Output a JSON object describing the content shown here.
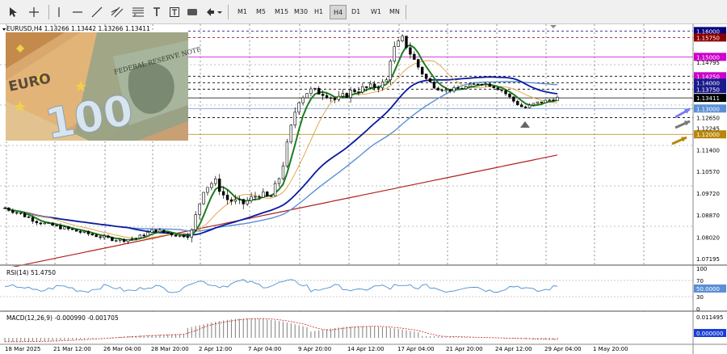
{
  "toolbar": {
    "timeframes": [
      "M1",
      "M5",
      "M15",
      "M30",
      "H1",
      "H4",
      "D1",
      "W1",
      "MN"
    ],
    "active_timeframe": "H4"
  },
  "chart": {
    "symbol_header": "EURUSD,H4  1.13266 1.13442 1.13266 1.13411",
    "price_axis": [
      "1.16000",
      "1.15750",
      "1.15000",
      "1.14250",
      "1.14000",
      "1.13750",
      "1.13411",
      "1.13000",
      "1.12650",
      "1.12245",
      "1.12000",
      "1.11400",
      "1.10570",
      "1.09720",
      "1.08870",
      "1.08020",
      "1.07195",
      "1.14795"
    ],
    "highlighted_levels": [
      {
        "price": "1.16000",
        "color": "#000080"
      },
      {
        "price": "1.15750",
        "color": "#8b0000"
      },
      {
        "price": "1.15000",
        "color": "#cc00cc"
      },
      {
        "price": "1.14250",
        "color": "#cc00cc"
      },
      {
        "price": "1.14000",
        "color": "#1a1a8c"
      },
      {
        "price": "1.13750",
        "color": "#1a1a8c"
      },
      {
        "price": "1.13411",
        "color": "#000000"
      },
      {
        "price": "1.13000",
        "color": "#5b8fd6"
      },
      {
        "price": "1.12000",
        "color": "#b8860b"
      }
    ],
    "time_axis": [
      "18 Mar 2025",
      "21 Mar 12:00",
      "26 Mar 04:00",
      "28 Mar 20:00",
      "2 Apr 12:00",
      "7 Apr 04:00",
      "9 Apr 20:00",
      "14 Apr 12:00",
      "17 Apr 04:00",
      "21 Apr 20:00",
      "24 Apr 12:00",
      "29 Apr 04:00",
      "1 May 20:00"
    ],
    "rsi_label": "RSI(14) 51.4750",
    "rsi_axis": [
      "100",
      "70",
      "50.0000",
      "30",
      "0"
    ],
    "macd_label": "MACD(12,26,9) -0.000990 -0.001705",
    "macd_axis": [
      "0.011495",
      "0.000000"
    ],
    "colors": {
      "ma_fast": "#1e7d1e",
      "ma_mid": "#e0a040",
      "ma_blue_light": "#5b8fd6",
      "ma_blue_dark": "#0a1aa0",
      "ma_red": "#b22222",
      "rsi_line": "#4a8fd0"
    },
    "image_text": [
      "EURO",
      "100",
      "FEDERAL RESERVE NOTE"
    ]
  }
}
